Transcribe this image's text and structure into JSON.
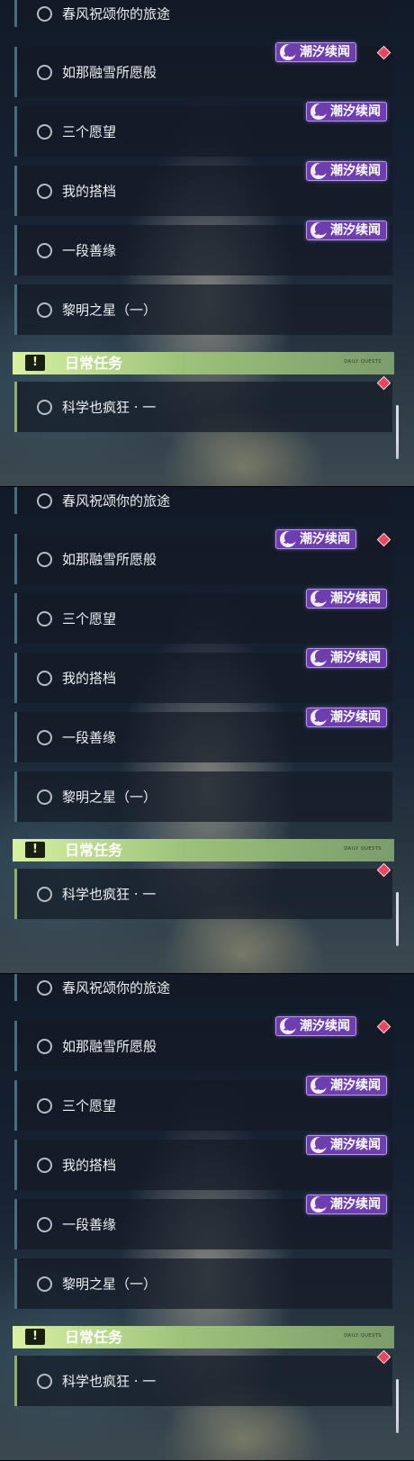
{
  "panels": [
    {
      "quests": [
        {
          "label": "春风祝颂你的旅途"
        },
        {
          "label": "如那融雪所愿般"
        },
        {
          "label": "三个愿望"
        },
        {
          "label": "我的搭档"
        },
        {
          "label": "一段善缘"
        },
        {
          "label": "黎明之星（一）"
        }
      ],
      "badges": [
        "潮汐续闻",
        "潮汐续闻",
        "潮汐续闻",
        "潮汐续闻"
      ],
      "section": {
        "title": "日常任务",
        "tag": "DAILY QUESTS",
        "icon": "exclamation-icon"
      },
      "daily_quest": {
        "label": "科学也疯狂 · 一"
      }
    },
    {
      "quests": [
        {
          "label": "春风祝颂你的旅途"
        },
        {
          "label": "如那融雪所愿般"
        },
        {
          "label": "三个愿望"
        },
        {
          "label": "我的搭档"
        },
        {
          "label": "一段善缘"
        },
        {
          "label": "黎明之星（一）"
        }
      ],
      "badges": [
        "潮汐续闻",
        "潮汐续闻",
        "潮汐续闻",
        "潮汐续闻"
      ],
      "section": {
        "title": "日常任务",
        "tag": "DAILY QUESTS",
        "icon": "exclamation-icon"
      },
      "daily_quest": {
        "label": "科学也疯狂 · 一"
      }
    },
    {
      "quests": [
        {
          "label": "春风祝颂你的旅途"
        },
        {
          "label": "如那融雪所愿般"
        },
        {
          "label": "三个愿望"
        },
        {
          "label": "我的搭档"
        },
        {
          "label": "一段善缘"
        },
        {
          "label": "黎明之星（一）"
        }
      ],
      "badges": [
        "潮汐续闻",
        "潮汐续闻",
        "潮汐续闻",
        "潮汐续闻"
      ],
      "section": {
        "title": "日常任务",
        "tag": "DAILY QUESTS",
        "icon": "exclamation-icon"
      },
      "daily_quest": {
        "label": "科学也疯狂 · 一"
      }
    }
  ],
  "colors": {
    "badge": "#6d3fae",
    "notification_dot": "#e8455e",
    "section_header": "#9cc27a"
  }
}
